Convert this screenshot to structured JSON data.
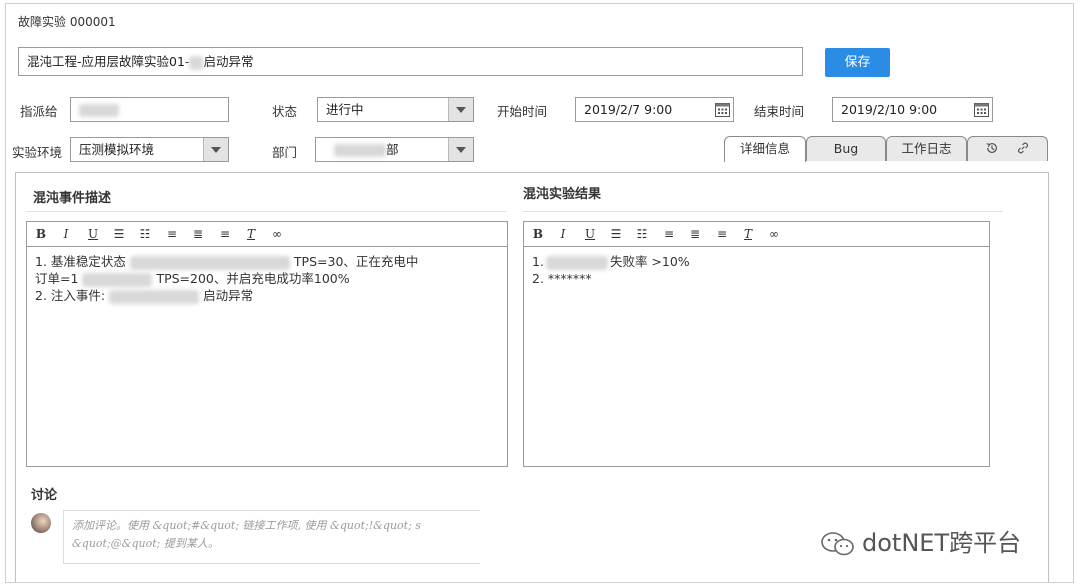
{
  "header": {
    "title": "故障实验 000001"
  },
  "title_field": {
    "value_prefix": "混沌工程-应用层故障实验01-",
    "value_suffix": "启动异常"
  },
  "save_button": {
    "label": "保存"
  },
  "fields": {
    "assignee": {
      "label": "指派给"
    },
    "state": {
      "label": "状态",
      "value": "进行中"
    },
    "start_time": {
      "label": "开始时间",
      "value": "2019/2/7 9:00"
    },
    "end_time": {
      "label": "结束时间",
      "value": "2019/2/10 9:00"
    },
    "env": {
      "label": "实验环境",
      "value": "压测模拟环境"
    },
    "department": {
      "label": "部门",
      "value_suffix": "部"
    }
  },
  "tabs": [
    {
      "label": "详细信息",
      "active": true
    },
    {
      "label": "Bug",
      "active": false
    },
    {
      "label": "工作日志",
      "active": false
    }
  ],
  "tab_icons": [
    "history-icon",
    "link-icon"
  ],
  "left_section": {
    "title": "混沌事件描述",
    "lines": [
      {
        "prefix": "1. 基准稳定状态",
        "suffix": "TPS=30、正在充电中"
      },
      {
        "prefix": "订单=1",
        "suffix": "TPS=200、并启充电成功率100%"
      },
      {
        "prefix": "2. 注入事件:",
        "suffix": "启动异常"
      }
    ]
  },
  "right_section": {
    "title": "混沌实验结果",
    "lines": [
      {
        "prefix": "1.",
        "suffix": "失败率 >10%"
      },
      {
        "prefix": "2. *******",
        "suffix": ""
      }
    ]
  },
  "toolbar_icons": [
    "bold-icon",
    "italic-icon",
    "underline-icon",
    "ordered-list-icon",
    "unordered-list-icon",
    "align-left-icon",
    "align-center-icon",
    "align-right-icon",
    "clear-format-icon",
    "link-icon"
  ],
  "discussion": {
    "title": "讨论",
    "placeholder": "添加评论。使用 &quot;#&quot; 链接工作项，使用 &quot;!&quot; 引用拉取请求，使用 &quot;@&quot; 提到某人。",
    "line1": "添加评论。使用 &quot;#&quot; 链接工作项, 使用 &quot;!&quot; s",
    "line2": "&quot;@&quot; 提到某人。"
  },
  "watermark": {
    "text": "dotNET跨平台"
  },
  "colors": {
    "accent": "#2b8ce6",
    "border": "#9a9a9a"
  }
}
